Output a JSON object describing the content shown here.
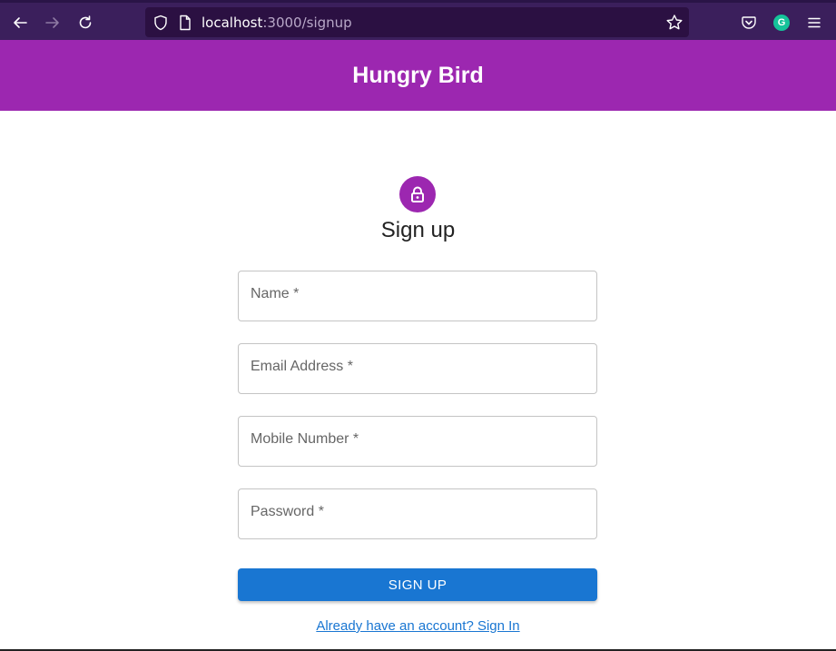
{
  "browser": {
    "url_host": "localhost",
    "url_path": ":3000/signup",
    "icons": [
      "back-icon",
      "forward-icon",
      "reload-icon",
      "shield-icon",
      "page-icon",
      "bookmark-star-icon",
      "pocket-icon",
      "grammarly-icon",
      "menu-icon"
    ],
    "grammarly_letter": "G"
  },
  "header": {
    "title": "Hungry Bird",
    "color": "#9c27b0"
  },
  "form": {
    "icon": "lock-icon",
    "title": "Sign up",
    "fields": {
      "name": "Name *",
      "email": "Email Address *",
      "mobile": "Mobile Number *",
      "password": "Password *"
    },
    "submit_label": "SIGN UP",
    "signin_link": "Already have an account? Sign In",
    "button_color": "#1976d2"
  }
}
